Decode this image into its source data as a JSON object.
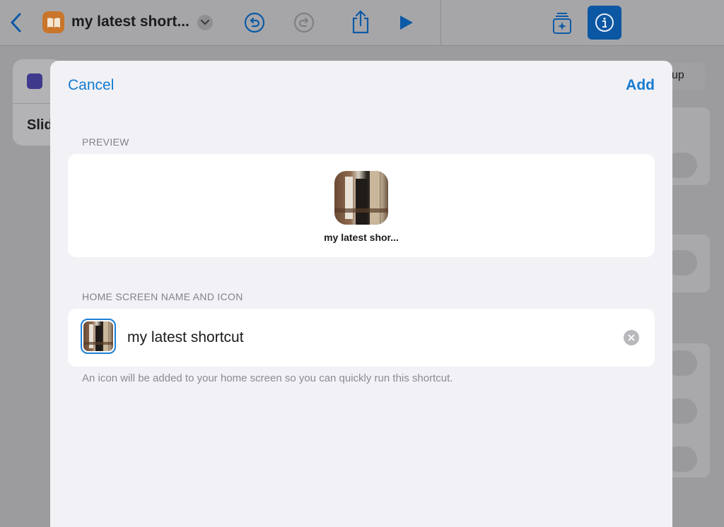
{
  "header": {
    "title": "my latest short...",
    "icons": {
      "back": "chevron-left-icon",
      "app": "book-icon",
      "menu": "chevron-down-icon",
      "undo": "undo-icon",
      "redo": "redo-icon",
      "share": "share-icon",
      "run": "play-icon",
      "gallery": "add-to-gallery-icon",
      "info": "info-icon"
    }
  },
  "background": {
    "left_card_label": "Slid",
    "right_button_label": "up"
  },
  "sheet": {
    "cancel_label": "Cancel",
    "add_label": "Add",
    "preview_section_label": "PREVIEW",
    "preview_name": "my latest shor...",
    "home_section_label": "HOME SCREEN NAME AND ICON",
    "name_value": "my latest shortcut",
    "hint": "An icon will be added to your home screen so you can quickly run this shortcut."
  },
  "colors": {
    "accent": "#147bd1",
    "sheet_background": "#f2f1f6",
    "dimmed_background": "#9c9c9f",
    "info_button": "#0c57a3"
  }
}
